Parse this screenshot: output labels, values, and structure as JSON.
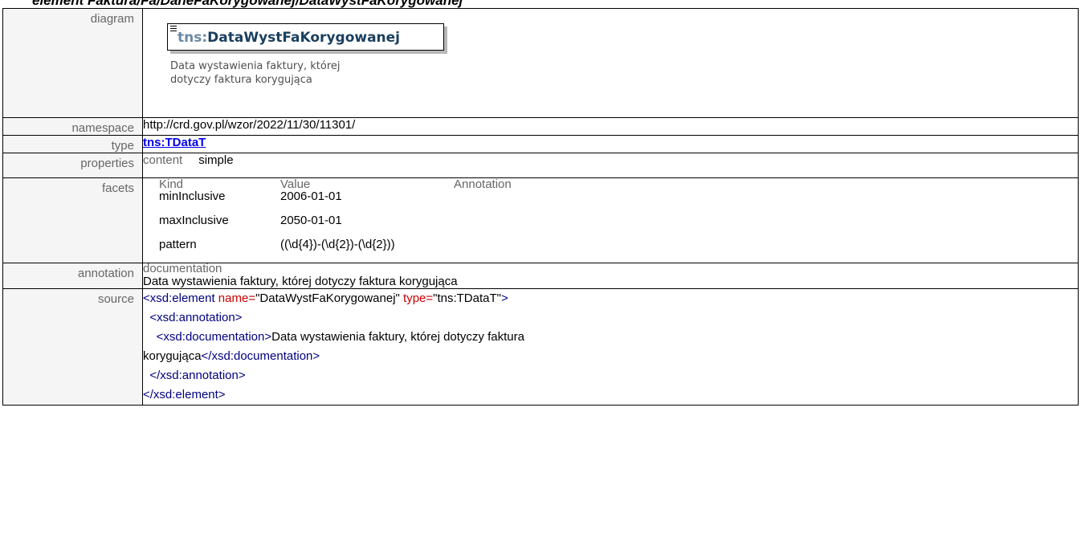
{
  "page_heading": "element Faktura/Fa/DaneFaKorygowanej/DataWystFaKorygowanej",
  "rows": {
    "diagram": {
      "label": "diagram",
      "element_ns": "tns:",
      "element_name": "DataWystFaKorygowanej",
      "note_line1": "Data wystawienia faktury, której",
      "note_line2": "dotyczy faktura korygująca"
    },
    "namespace": {
      "label": "namespace",
      "value": "http://crd.gov.pl/wzor/2022/11/30/11301/"
    },
    "type": {
      "label": "type",
      "value": "tns:TDataT"
    },
    "properties": {
      "label": "properties",
      "key": "content",
      "value": "simple"
    },
    "facets": {
      "label": "facets",
      "headers": {
        "kind": "Kind",
        "value": "Value",
        "annotation": "Annotation"
      },
      "items": [
        {
          "kind": "minInclusive",
          "value": "2006-01-01"
        },
        {
          "kind": "maxInclusive",
          "value": "2050-01-01"
        },
        {
          "kind": "pattern",
          "value": "((\\d{4})-(\\d{2})-(\\d{2}))"
        }
      ]
    },
    "annotation": {
      "label": "annotation",
      "key": "documentation",
      "value": "Data wystawienia faktury, której dotyczy faktura korygująca"
    },
    "source": {
      "label": "source",
      "l1_open": "<xsd:element",
      "l1_attr1": " name=",
      "l1_val1": "\"DataWystFaKorygowanej\"",
      "l1_attr2": " type=",
      "l1_val2": "\"tns:TDataT\"",
      "l1_close": ">",
      "l2": "  <xsd:annotation>",
      "l3_open": "    <xsd:documentation>",
      "l3_text": "Data wystawienia faktury, której dotyczy faktura",
      "l4_text": "korygująca",
      "l4_close": "</xsd:documentation>",
      "l5": "  </xsd:annotation>",
      "l6": "</xsd:element>"
    }
  }
}
